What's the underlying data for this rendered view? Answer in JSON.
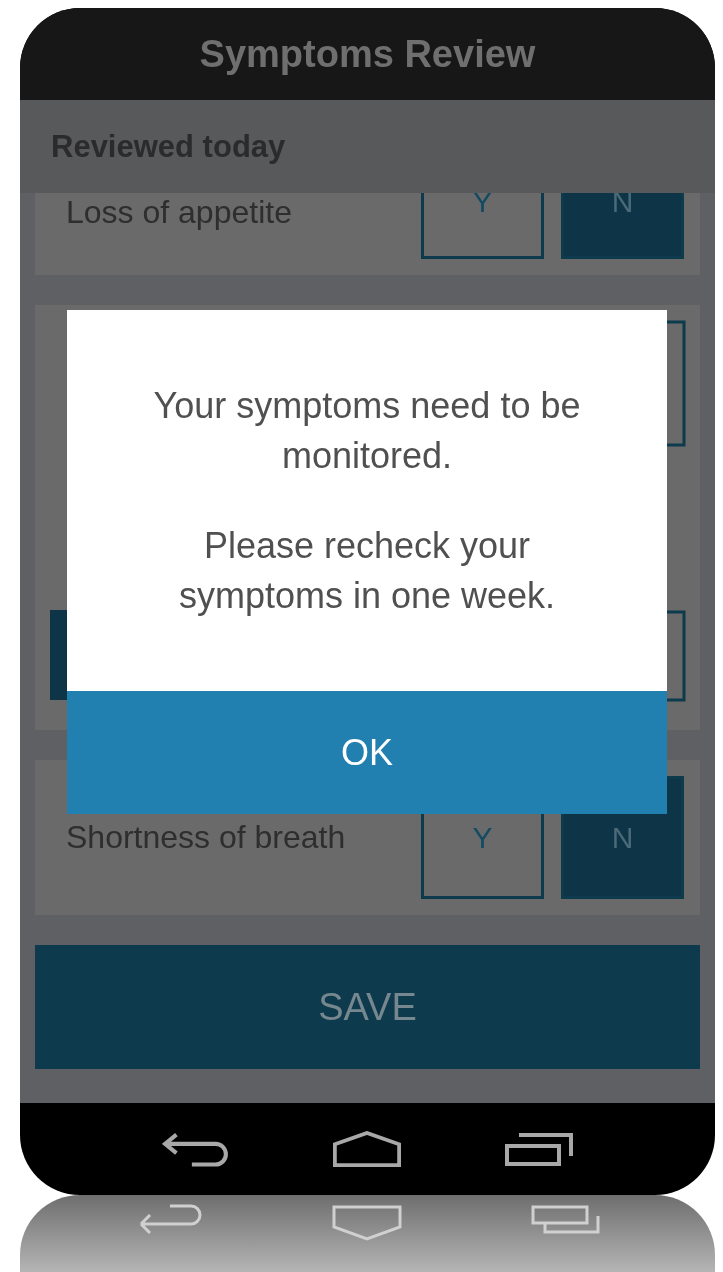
{
  "app_bar": {
    "title": "Symptoms Review"
  },
  "status_header": {
    "text": "Reviewed today"
  },
  "symptoms": [
    {
      "name": "Loss of appetite",
      "options": [
        {
          "label": "Y",
          "selected": false
        },
        {
          "label": "N",
          "selected": true
        }
      ]
    },
    {
      "name": "Shortness of breath",
      "options": [
        {
          "label": "Y",
          "selected": false
        },
        {
          "label": "N",
          "selected": true
        }
      ]
    }
  ],
  "save_button": {
    "label": "SAVE"
  },
  "dialog": {
    "paragraphs": [
      "Your symptoms need to be monitored.",
      "Please recheck your symptoms in one week."
    ],
    "button": "OK"
  }
}
